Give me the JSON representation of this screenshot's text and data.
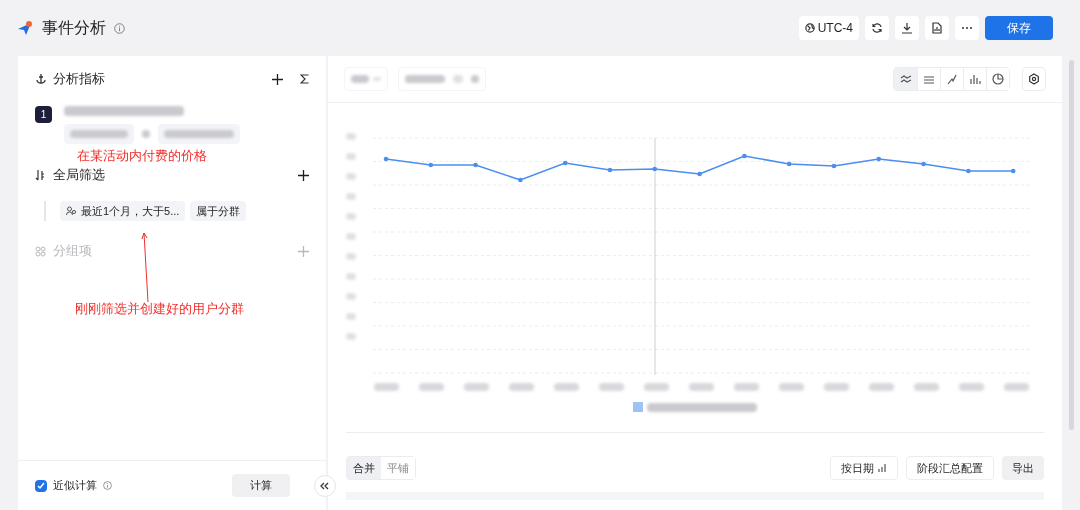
{
  "header": {
    "title": "事件分析",
    "timezone": "UTC-4",
    "save": "保存"
  },
  "metrics": {
    "title": "分析指标",
    "index": "1"
  },
  "filters": {
    "title": "全局筛选",
    "condition": "最近1个月，大于5...",
    "operator": "属于分群"
  },
  "group_by": {
    "title": "分组项",
    "disabled": true
  },
  "annotations": [
    {
      "text": "在某活动内付费的价格"
    },
    {
      "text": "刚刚筛选并创建好的用户分群"
    }
  ],
  "footer": {
    "approx_label": "近似计算",
    "approx_checked": true,
    "compute": "计算"
  },
  "chart_types": [
    {
      "kind": "line",
      "selected": true
    },
    {
      "kind": "area",
      "selected": false
    },
    {
      "kind": "scatter",
      "selected": false
    },
    {
      "kind": "bar",
      "selected": false
    },
    {
      "kind": "pie",
      "selected": false
    }
  ],
  "table": {
    "tabs": [
      {
        "label": "合并",
        "selected": true
      },
      {
        "label": "平铺",
        "selected": false
      }
    ],
    "by_date": "按日期",
    "stage_config": "阶段汇总配置",
    "export": "导出"
  }
}
